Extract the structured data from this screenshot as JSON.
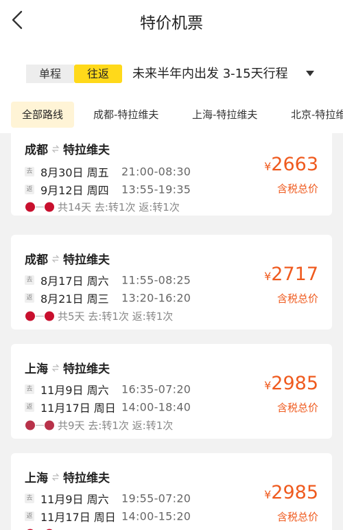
{
  "header": {
    "title": "特价机票"
  },
  "filter": {
    "oneway_label": "单程",
    "roundtrip_label": "往返",
    "selected": "往返",
    "summary": "未来半年内出发 3-15天行程"
  },
  "route_tabs": [
    "全部路线",
    "成都-特拉维夫",
    "上海-特拉维夫",
    "北京-特拉维夫"
  ],
  "currency_symbol": "¥",
  "depart_badge": "去",
  "return_badge": "返",
  "price_note": "含税总价",
  "colors": {
    "accent": "#ffd91a",
    "price": "#ef5a1e"
  },
  "cards": [
    {
      "from": "成都",
      "to": "特拉维夫",
      "depart_date": "8月30日 周五",
      "depart_time": "21:00-08:30",
      "return_date": "9月12日 周四",
      "return_time": "13:55-19:35",
      "summary": "共14天 去:转1次 返:转1次",
      "price": "2663"
    },
    {
      "from": "成都",
      "to": "特拉维夫",
      "depart_date": "8月17日 周六",
      "depart_time": "11:55-08:25",
      "return_date": "8月21日 周三",
      "return_time": "13:20-16:20",
      "summary": "共5天 去:转1次 返:转1次",
      "price": "2717"
    },
    {
      "from": "上海",
      "to": "特拉维夫",
      "depart_date": "11月9日 周六",
      "depart_time": "16:35-07:20",
      "return_date": "11月17日 周日",
      "return_time": "14:00-18:40",
      "summary": "共9天 去:转1次 返:转1次",
      "price": "2985"
    },
    {
      "from": "上海",
      "to": "特拉维夫",
      "depart_date": "11月9日 周六",
      "depart_time": "19:55-07:20",
      "return_date": "11月17日 周日",
      "return_time": "14:00-15:20",
      "summary": "",
      "price": "2985"
    }
  ]
}
